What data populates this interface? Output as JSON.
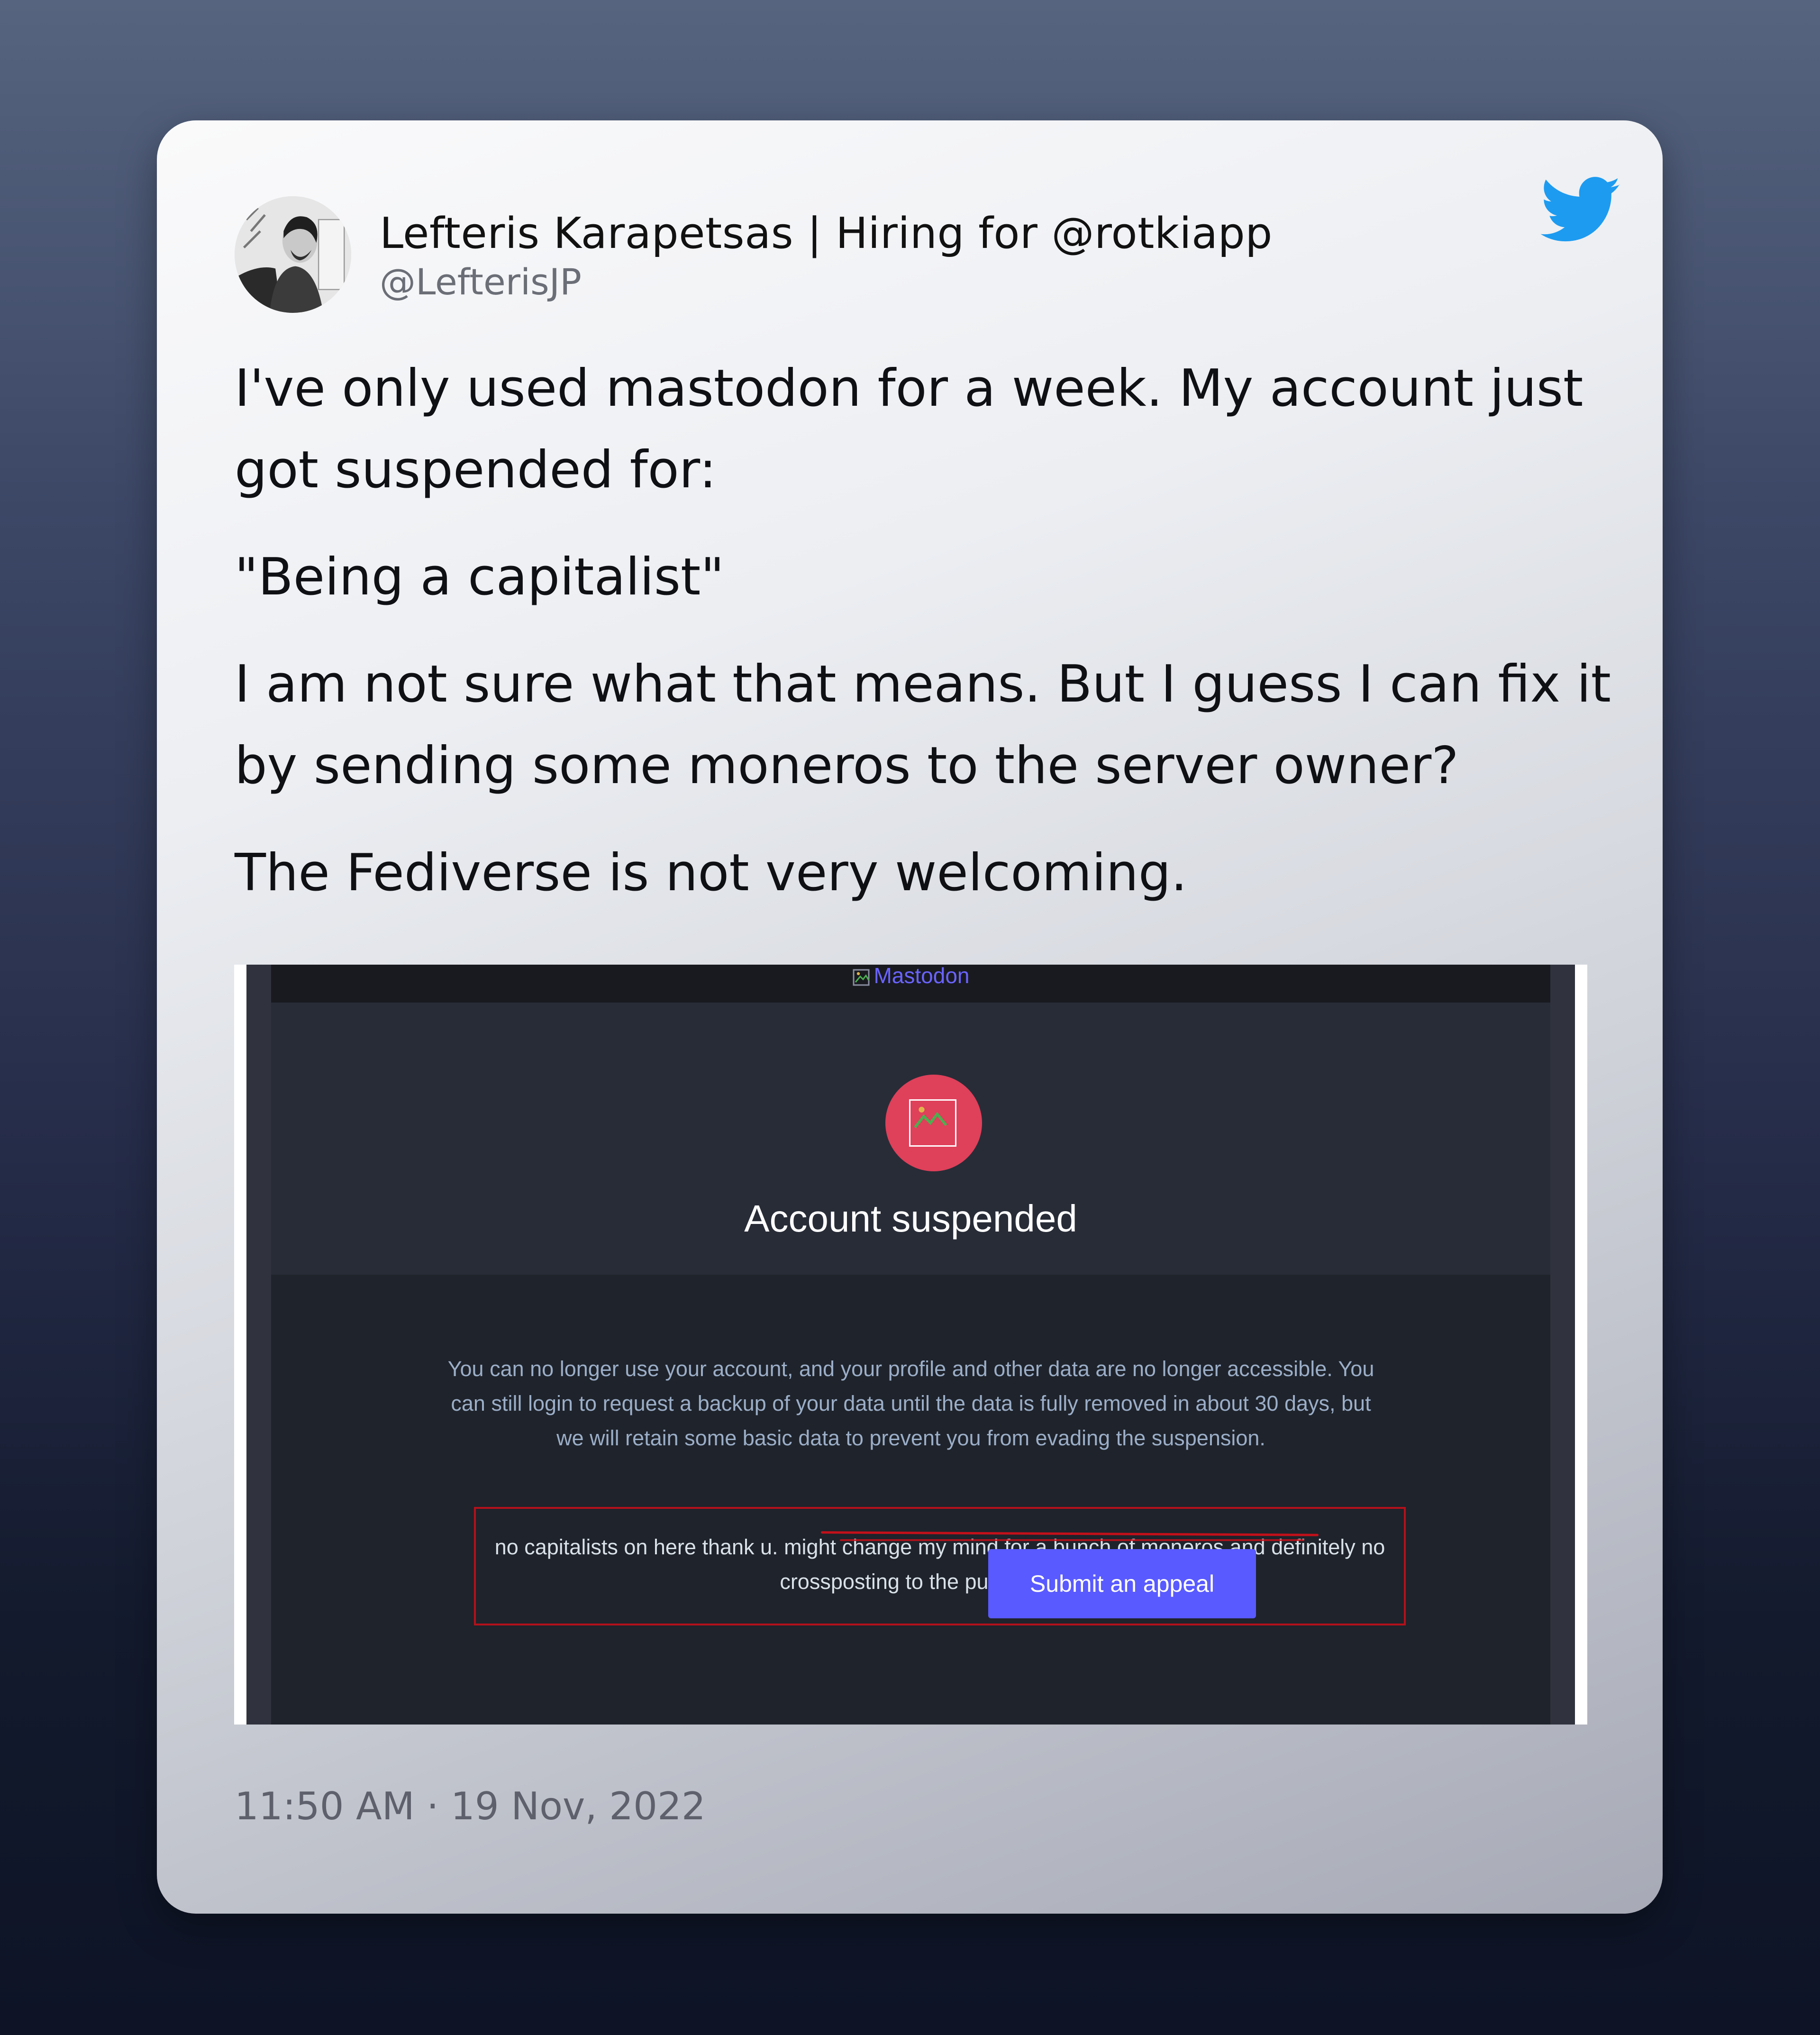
{
  "tweet": {
    "display_name": "Lefteris Karapetsas | Hiring for @rotkiapp",
    "handle": "@LefterisJP",
    "paragraphs": [
      "I've only used mastodon for a week. My account just got suspended for:",
      "\"Being a capitalist\"",
      "I am not sure what that means. But I guess I can fix it by sending some moneros to the server owner?",
      "The Fediverse is not very welcoming."
    ],
    "timestamp": "11:50 AM · 19 Nov, 2022",
    "icons": {
      "platform": "twitter-bird-icon",
      "avatar": "user-avatar"
    },
    "colors": {
      "bird": "#1d9bf0",
      "text": "#0f1014",
      "handle": "#6b6e76"
    }
  },
  "embedded_screenshot": {
    "logo_alt": "Mastodon",
    "title": "Account suspended",
    "description": "You can no longer use your account, and your profile and other data are no longer accessible. You can still login to request a backup of your data until the data is fully removed in about 30 days, but we will retain some basic data to prevent you from evading the suspension.",
    "reason": "no capitalists on here thank u. might change my mind for a bunch of moneros and definitely no crossposting to the public timeline",
    "appeal_button": "Submit an appeal",
    "colors": {
      "badge": "#df405a",
      "button": "#595aff",
      "highlight_box": "#b3111b",
      "background": "#282c37"
    }
  }
}
